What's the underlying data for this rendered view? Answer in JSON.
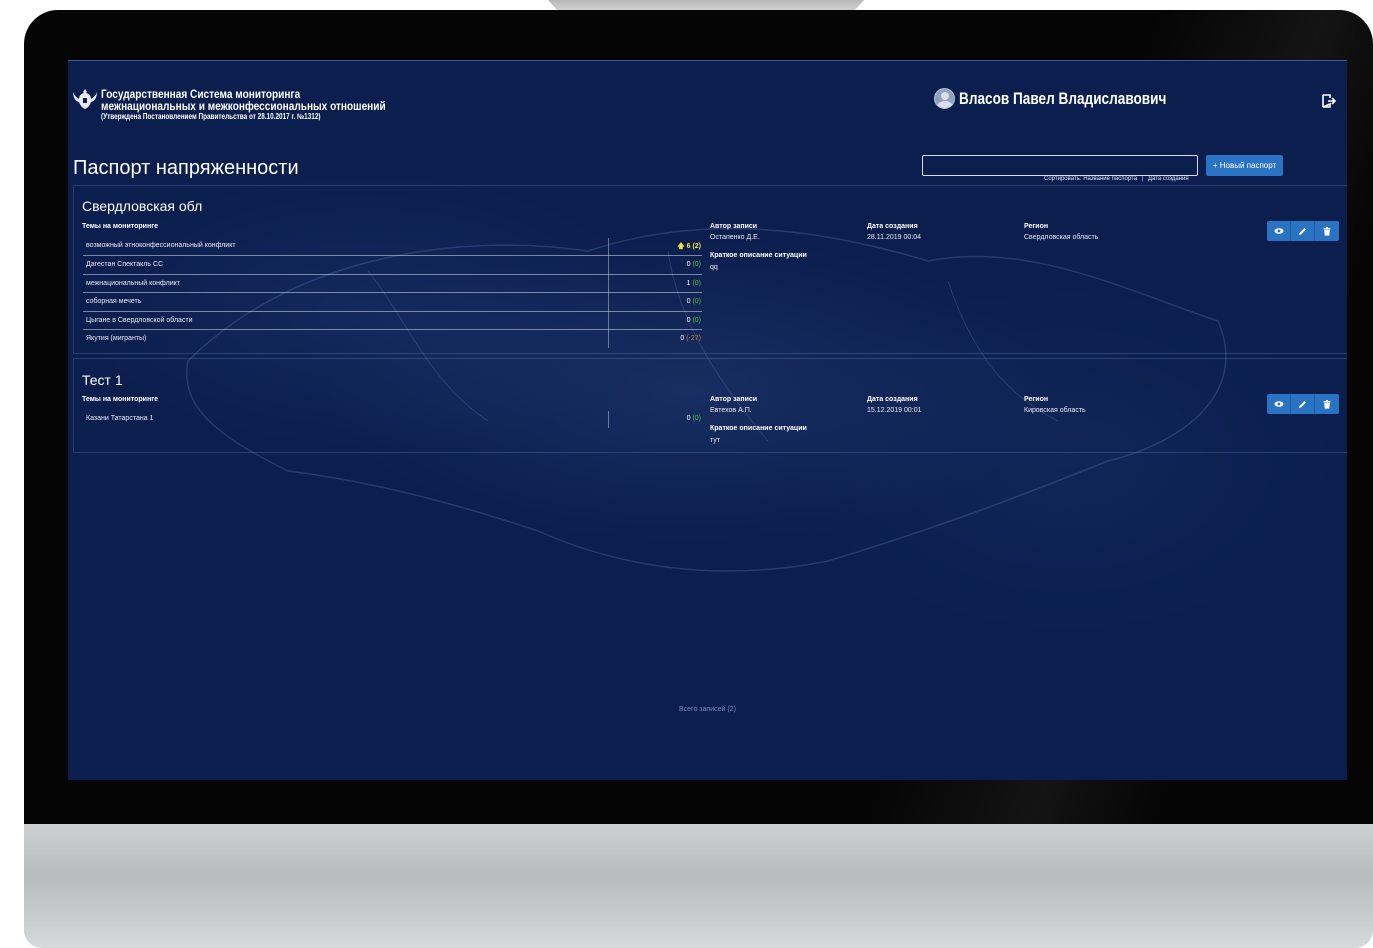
{
  "header": {
    "org_line1": "Государственная Система мониторинга",
    "org_line2": "межнациональных и межконфессиональных отношений",
    "org_line3": "(Утверждена Постановлением Правительства от 28.10.2017 г. №1312)",
    "user_name": "Власов Павел Владиславович"
  },
  "page": {
    "title": "Паспорт напряженности",
    "search_value": "",
    "new_button_label": "+ Новый паспорт",
    "sort": {
      "label": "Сортировать:",
      "by_name": "Название паспорта",
      "separator": "|",
      "by_date": "Дата создания"
    }
  },
  "labels": {
    "topics": "Темы на мониторинге",
    "author": "Автор записи",
    "created": "Дата создания",
    "region": "Регион",
    "summary": "Краткое описание ситуации"
  },
  "cards": [
    {
      "title": "Свердловская обл",
      "author": "Остапенко Д.Е.",
      "created": "28.11.2019 00:04",
      "region": "Свердловская область",
      "summary": "qq",
      "topics": [
        {
          "name": "возможный этноконфессиональный конфликт",
          "value": "6",
          "delta": "(2)",
          "trend": "up"
        },
        {
          "name": "Дагестан Спектакль СС",
          "value": "0",
          "delta": "(0)",
          "trend": "none"
        },
        {
          "name": "межнациональный конфликт",
          "value": "1",
          "delta": "(0)",
          "trend": "none"
        },
        {
          "name": "соборная мечеть",
          "value": "0",
          "delta": "(0)",
          "trend": "none"
        },
        {
          "name": "Цыгане в Свердловской области",
          "value": "0",
          "delta": "(0)",
          "trend": "none"
        },
        {
          "name": "Якутия (мигранты)",
          "value": "0",
          "delta": "(-27)",
          "trend": "down"
        }
      ]
    },
    {
      "title": "Тест 1",
      "author": "Евтехов А.П.",
      "created": "15.12.2019 00:01",
      "region": "Кировская область",
      "summary": "тут",
      "topics": [
        {
          "name": "Казани Татарстана 1",
          "value": "0",
          "delta": "(0)",
          "trend": "none"
        }
      ]
    }
  ],
  "footer": {
    "total": "Всего записей (2)"
  },
  "icons": {
    "emblem": "emblem-icon",
    "avatar": "avatar-icon",
    "logout": "logout-icon",
    "view": "eye-icon",
    "edit": "pencil-icon",
    "delete": "trash-icon",
    "trend_up": "arrow-up-icon"
  },
  "colors": {
    "screen_background": "#0b1e4d",
    "accent_button": "#2a73c2",
    "delta_zero": "#48c24a",
    "delta_negative": "#d0842b",
    "trend_up": "#f0e23a"
  }
}
